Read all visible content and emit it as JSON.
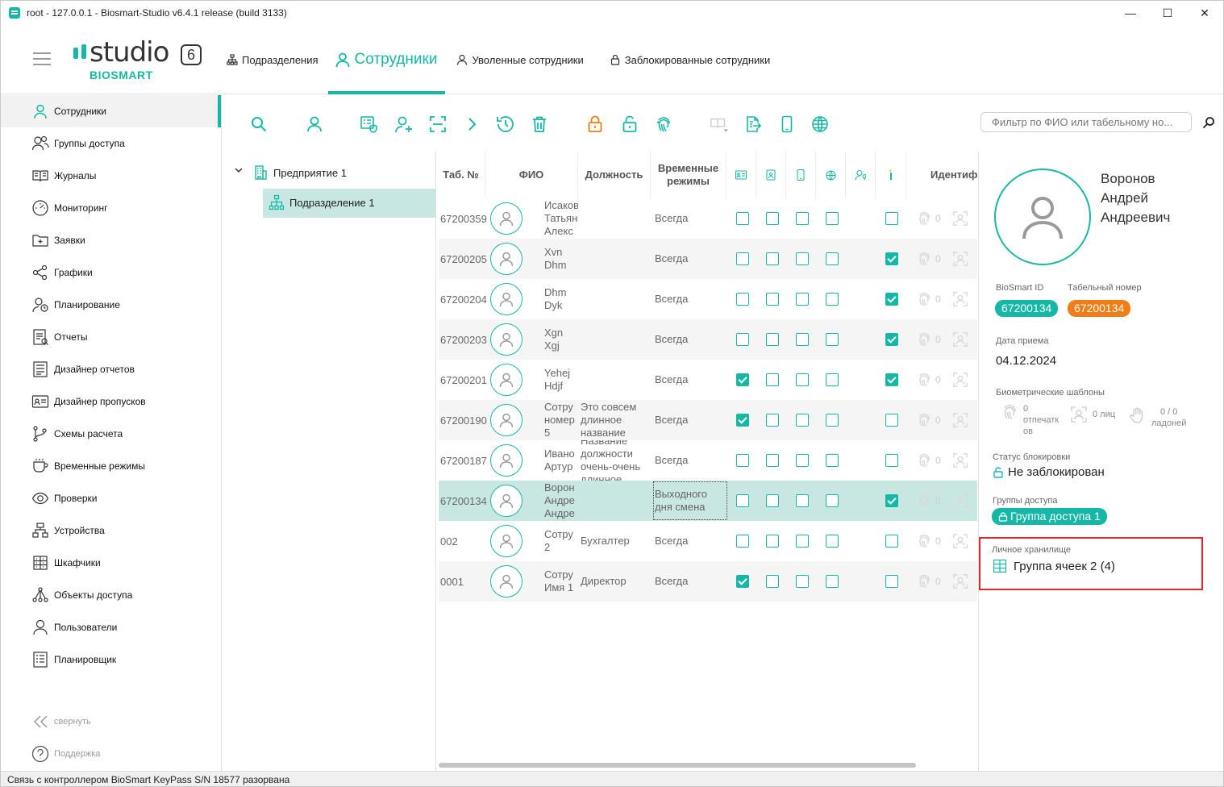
{
  "window": {
    "title": "root - 127.0.0.1 - Biosmart-Studio v6.4.1 release (build 3133)",
    "minimize": "—",
    "maximize": "☐",
    "close": "✕"
  },
  "logo": {
    "word": "studio",
    "version": "6",
    "brand": "BIOSMART"
  },
  "topnav": [
    {
      "label": "Подразделения",
      "icon": "hierarchy-icon"
    },
    {
      "label": "Сотрудники",
      "icon": "person-icon",
      "active": true
    },
    {
      "label": "Уволенные сотрудники",
      "icon": "person-icon"
    },
    {
      "label": "Заблокированные сотрудники",
      "icon": "lock-icon"
    }
  ],
  "sidebar": {
    "items": [
      {
        "label": "Сотрудники",
        "icon": "person-icon",
        "active": true
      },
      {
        "label": "Группы доступа",
        "icon": "group-icon"
      },
      {
        "label": "Журналы",
        "icon": "book-icon"
      },
      {
        "label": "Мониторинг",
        "icon": "gauge-icon"
      },
      {
        "label": "Заявки",
        "icon": "folder-add-icon"
      },
      {
        "label": "Графики",
        "icon": "share-icon"
      },
      {
        "label": "Планирование",
        "icon": "person-clock-icon"
      },
      {
        "label": "Отчеты",
        "icon": "report-icon"
      },
      {
        "label": "Дизайнер отчетов",
        "icon": "report-designer-icon"
      },
      {
        "label": "Дизайнер пропусков",
        "icon": "id-card-icon"
      },
      {
        "label": "Схемы расчета",
        "icon": "branch-icon"
      },
      {
        "label": "Временные режимы",
        "icon": "cup-icon"
      },
      {
        "label": "Проверки",
        "icon": "eye-icon"
      },
      {
        "label": "Устройства",
        "icon": "devices-icon"
      },
      {
        "label": "Шкафчики",
        "icon": "lockers-icon"
      },
      {
        "label": "Объекты доступа",
        "icon": "access-objects-icon"
      },
      {
        "label": "Пользователи",
        "icon": "user-icon"
      },
      {
        "label": "Планировщик",
        "icon": "scheduler-icon"
      }
    ],
    "collapse": "свернуть",
    "support": "Поддержка"
  },
  "toolbar": {
    "search_placeholder": "Фильтр по ФИО или табельному но..."
  },
  "tree": {
    "root": "Предприятие 1",
    "child": "Подразделение 1"
  },
  "table": {
    "headers": {
      "tab": "Таб. №",
      "fio": "ФИО",
      "position": "Должность",
      "schedule_1": "Временные",
      "schedule_2": "режимы",
      "ident": "Идентиф"
    },
    "rows": [
      {
        "tab": "67200359",
        "fio": "Исаков Татьяна Алекс",
        "position": "",
        "schedule": "Всегда",
        "checks": [
          false,
          false,
          false,
          false,
          false
        ],
        "bio": "0"
      },
      {
        "tab": "67200205",
        "fio": "Xvn Dhm",
        "position": "",
        "schedule": "Всегда",
        "checks": [
          false,
          false,
          false,
          false,
          true
        ],
        "bio": "0"
      },
      {
        "tab": "67200204",
        "fio": "Dhm Dyk",
        "position": "",
        "schedule": "Всегда",
        "checks": [
          false,
          false,
          false,
          false,
          true
        ],
        "bio": "0"
      },
      {
        "tab": "67200203",
        "fio": "Xgn Xgj",
        "position": "",
        "schedule": "Всегда",
        "checks": [
          false,
          false,
          false,
          false,
          true
        ],
        "bio": "0"
      },
      {
        "tab": "67200201",
        "fio": "Yehej Hdjf",
        "position": "",
        "schedule": "Всегда",
        "checks": [
          true,
          false,
          false,
          false,
          true
        ],
        "bio": "0"
      },
      {
        "tab": "67200190",
        "fio": "Сотру номер 5",
        "position": "Это совсем длинное название",
        "schedule": "Всегда",
        "checks": [
          true,
          false,
          false,
          false,
          false
        ],
        "bio": "0"
      },
      {
        "tab": "67200187",
        "fio": "Ивано Артур",
        "position": "Название должности очень-очень длинное",
        "schedule": "Всегда",
        "checks": [
          false,
          false,
          false,
          false,
          false
        ],
        "bio": "0"
      },
      {
        "tab": "67200134",
        "fio": "Ворон Андре Андре",
        "position": "",
        "schedule": "Выходного дня смена",
        "checks": [
          false,
          false,
          false,
          false,
          true
        ],
        "bio": "0",
        "selected": true
      },
      {
        "tab": "002",
        "fio": "Сотру 2",
        "position": "Бухгалтер",
        "schedule": "Всегда",
        "checks": [
          false,
          false,
          false,
          false,
          false
        ],
        "bio": "0"
      },
      {
        "tab": "0001",
        "fio": "Сотру Имя 1",
        "position": "Директор",
        "schedule": "Всегда",
        "checks": [
          true,
          false,
          false,
          false,
          false
        ],
        "bio": "0"
      }
    ]
  },
  "detail": {
    "name_line1": "Воронов",
    "name_line2": "Андрей",
    "name_line3": "Андреевич",
    "biosmart_id_label": "BioSmart ID",
    "biosmart_id": "67200134",
    "tab_label": "Табельный номер",
    "tab_value": "67200134",
    "hire_label": "Дата приема",
    "hire_date": "04.12.2024",
    "bio_label": "Биометрические шаблоны",
    "bio_fingers_count": "0",
    "bio_fingers_text": "отпечатк ов",
    "bio_faces": "0 лиц",
    "bio_palms_count": "0 / 0",
    "bio_palms_text": "ладоней",
    "block_label": "Статус блокировки",
    "block_value": "Не заблокирован",
    "groups_label": "Группы доступа",
    "group_value": "Группа доступа 1",
    "storage_label": "Личное хранилище",
    "storage_value": "Группа ячеек 2 (4)"
  },
  "colors": {
    "accent": "#15b8a6",
    "orange": "#f07d16",
    "highlight": "#e0262b"
  },
  "status": "Связь с контроллером BioSmart KeyPass S/N 18577 разорвана"
}
